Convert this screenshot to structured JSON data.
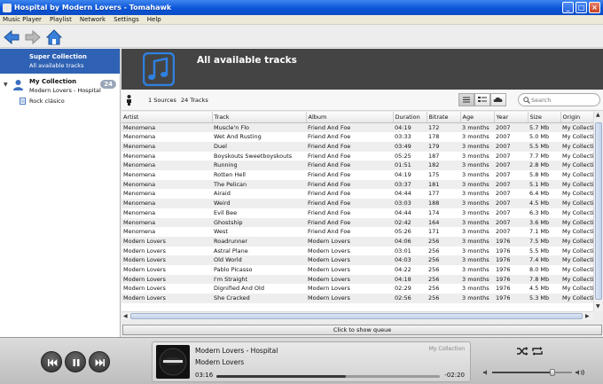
{
  "window": {
    "title": "Hospital by Modern Lovers - Tomahawk"
  },
  "menu": [
    "Music Player",
    "Playlist",
    "Network",
    "Settings",
    "Help"
  ],
  "sidebar": {
    "selected": {
      "title": "Super Collection",
      "subtitle": "All available tracks"
    },
    "collection": {
      "title": "My Collection",
      "subtitle": "Modern Lovers - Hospital",
      "count": "24"
    },
    "playlists": [
      {
        "label": "Rock clásico"
      }
    ]
  },
  "header": {
    "title": "All available tracks"
  },
  "filterbar": {
    "sources": "1 Sources",
    "tracks": "24 Tracks",
    "search_placeholder": "Search"
  },
  "table": {
    "columns": [
      "Artist",
      "Track",
      "Album",
      "Duration",
      "Bitrate",
      "Age",
      "Year",
      "Size",
      "Origin"
    ],
    "rows": [
      [
        "Menomena",
        "Muscle'n Flo",
        "Friend And Foe",
        "04:19",
        "172",
        "3 months",
        "2007",
        "5.7 Mb",
        "My Collection"
      ],
      [
        "Menomena",
        "Wet And Rusting",
        "Friend And Foe",
        "03:33",
        "178",
        "3 months",
        "2007",
        "5.0 Mb",
        "My Collection"
      ],
      [
        "Menomena",
        "Duel",
        "Friend And Foe",
        "03:49",
        "179",
        "3 months",
        "2007",
        "5.5 Mb",
        "My Collection"
      ],
      [
        "Menomena",
        "Boyskouts Sweetboyskouts",
        "Friend And Foe",
        "05:25",
        "187",
        "3 months",
        "2007",
        "7.7 Mb",
        "My Collection"
      ],
      [
        "Menomena",
        "Running",
        "Friend And Foe",
        "01:51",
        "182",
        "3 months",
        "2007",
        "2.8 Mb",
        "My Collection"
      ],
      [
        "Menomena",
        "Rotten Hell",
        "Friend And Foe",
        "04:19",
        "175",
        "3 months",
        "2007",
        "5.8 Mb",
        "My Collection"
      ],
      [
        "Menomena",
        "The Pelican",
        "Friend And Foe",
        "03:37",
        "181",
        "3 months",
        "2007",
        "5.1 Mb",
        "My Collection"
      ],
      [
        "Menomena",
        "Airaid",
        "Friend And Foe",
        "04:44",
        "177",
        "3 months",
        "2007",
        "6.4 Mb",
        "My Collection"
      ],
      [
        "Menomena",
        "Weird",
        "Friend And Foe",
        "03:03",
        "188",
        "3 months",
        "2007",
        "4.5 Mb",
        "My Collection"
      ],
      [
        "Menomena",
        "Evil Bee",
        "Friend And Foe",
        "04:44",
        "174",
        "3 months",
        "2007",
        "6.3 Mb",
        "My Collection"
      ],
      [
        "Menomena",
        "Ghostship",
        "Friend And Foe",
        "02:42",
        "164",
        "3 months",
        "2007",
        "3.6 Mb",
        "My Collection"
      ],
      [
        "Menomena",
        "West",
        "Friend And Foe",
        "05:26",
        "171",
        "3 months",
        "2007",
        "7.1 Mb",
        "My Collection"
      ],
      [
        "Modern Lovers",
        "Roadrunner",
        "Modern Lovers",
        "04:06",
        "256",
        "3 months",
        "1976",
        "7.5 Mb",
        "My Collection"
      ],
      [
        "Modern Lovers",
        "Astral Plane",
        "Modern Lovers",
        "03:01",
        "256",
        "3 months",
        "1976",
        "5.5 Mb",
        "My Collection"
      ],
      [
        "Modern Lovers",
        "Old World",
        "Modern Lovers",
        "04:03",
        "256",
        "3 months",
        "1976",
        "7.4 Mb",
        "My Collection"
      ],
      [
        "Modern Lovers",
        "Pablo Picasso",
        "Modern Lovers",
        "04:22",
        "256",
        "3 months",
        "1976",
        "8.0 Mb",
        "My Collection"
      ],
      [
        "Modern Lovers",
        "I'm Straight",
        "Modern Lovers",
        "04:18",
        "256",
        "3 months",
        "1976",
        "7.8 Mb",
        "My Collection"
      ],
      [
        "Modern Lovers",
        "Dignified And Old",
        "Modern Lovers",
        "02:29",
        "256",
        "3 months",
        "1976",
        "4.5 Mb",
        "My Collection"
      ],
      [
        "Modern Lovers",
        "She Cracked",
        "Modern Lovers",
        "02:56",
        "256",
        "3 months",
        "1976",
        "5.3 Mb",
        "My Collection"
      ]
    ]
  },
  "queue": {
    "label": "Click to show queue"
  },
  "player": {
    "artist_track": "Modern Lovers  -  Hospital",
    "album": "Modern Lovers",
    "source": "My Collection",
    "elapsed": "03:16",
    "remaining": "-02:20",
    "progress_fraction": 0.58,
    "volume_fraction": 0.75
  }
}
